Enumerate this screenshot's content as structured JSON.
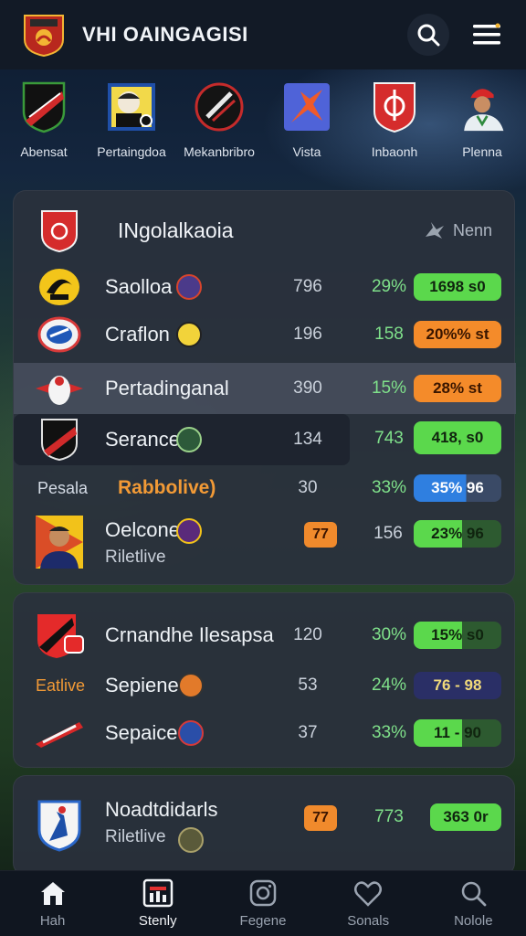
{
  "header": {
    "title": "VHI OAINGAGISI",
    "search_icon": "search-icon",
    "menu_icon": "hamburger-menu-icon"
  },
  "teams_strip": [
    {
      "name": "Abensat",
      "crest": "black-red-shield"
    },
    {
      "name": "Pertaingdoa",
      "crest": "portrait-badge"
    },
    {
      "name": "Mekanbribro",
      "crest": "dark-slash-crest"
    },
    {
      "name": "Vista",
      "crest": "orange-figure-crest"
    },
    {
      "name": "Inbaonh",
      "crest": "red-shield"
    },
    {
      "name": "Plenna",
      "crest": "player-photo"
    }
  ],
  "card1": {
    "title": "INgolalkaoia",
    "right_label": "Nenn",
    "rows": [
      {
        "name": "Saolloa",
        "a": "796",
        "b": "29%",
        "pill": "1698 s0",
        "pill_style": "green"
      },
      {
        "name": "Craflon",
        "a": "196",
        "b": "158",
        "pill": "20%% st",
        "pill_style": "orange"
      },
      {
        "name": "Pertadinganal",
        "a": "390",
        "b": "15%",
        "pill": "28% st",
        "pill_style": "orange"
      },
      {
        "name": "Serance",
        "a": "134",
        "b": "743",
        "pill": "418, s0",
        "pill_style": "green"
      },
      {
        "side": "Pesala",
        "name": "Rabbolive)",
        "a": "30",
        "b": "33%",
        "pill": "35%  96",
        "pill_style": "blue"
      },
      {
        "name": "Oelcone",
        "sub": "Riletlive",
        "tag": "77",
        "b": "156",
        "pill": "23%  96",
        "pill_style": "green-half"
      }
    ]
  },
  "card2": {
    "rows": [
      {
        "name": "Crnandhe Ilesapsa",
        "a": "120",
        "b": "30%",
        "pill": "15%  s0",
        "pill_style": "green-half"
      },
      {
        "side": "Eatlive",
        "name": "Sepiene",
        "a": "53",
        "b": "24%",
        "pill": "76 - 98",
        "pill_style": "navy"
      },
      {
        "name": "Sepaice",
        "a": "37",
        "b": "33%",
        "pill": "11 - 90",
        "pill_style": "green-half"
      }
    ]
  },
  "card3": {
    "rows": [
      {
        "name": "Noadtdidarls",
        "sub": "Riletlive",
        "tag": "77",
        "b": "773",
        "pill": "363 0r",
        "pill_style": "green"
      }
    ]
  },
  "bottom_nav": [
    {
      "label": "Hah",
      "icon": "home-icon"
    },
    {
      "label": "Stenly",
      "icon": "stats-icon",
      "active": true
    },
    {
      "label": "Fegene",
      "icon": "instagram-icon"
    },
    {
      "label": "Sonals",
      "icon": "heart-icon"
    },
    {
      "label": "Nolole",
      "icon": "search-icon"
    }
  ],
  "colors": {
    "pill_green": "#5bd84c",
    "pill_orange": "#f48b2a",
    "pill_blue": "#2f7fe0",
    "accent_orange_text": "#f29a36",
    "percent_green": "#7fe08a"
  }
}
